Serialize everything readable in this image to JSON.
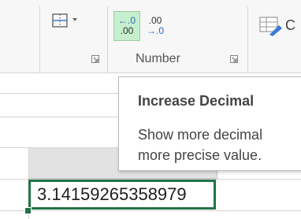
{
  "ribbon": {
    "group_label": "Number",
    "partial_button_label": "C",
    "buttons": {
      "increase_decimal": {
        "top": "←.0",
        "bottom": ".00"
      },
      "decrease_decimal": {
        "top": ".00",
        "bottom": "→.0"
      }
    }
  },
  "tooltip": {
    "title": "Increase Decimal",
    "line1": "Show more decimal",
    "line2": "more precise value."
  },
  "cell": {
    "value": "3.14159265358979"
  },
  "colors": {
    "accent": "#217346",
    "hover": "#c6efce"
  }
}
